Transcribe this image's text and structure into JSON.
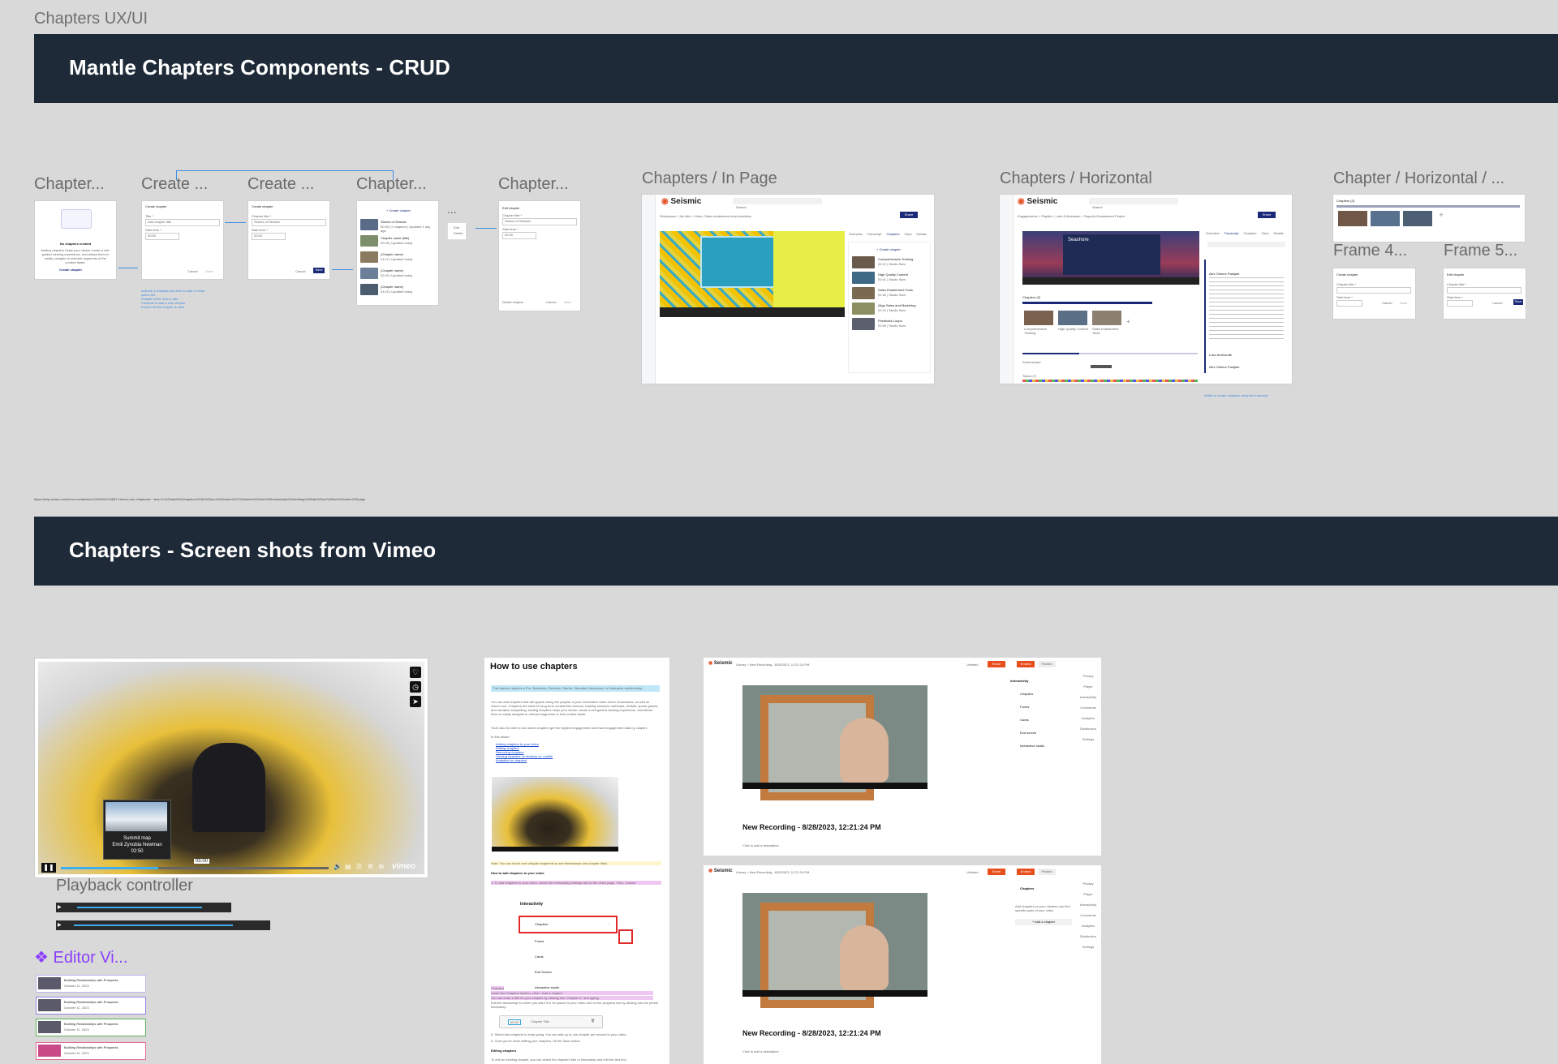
{
  "page": {
    "title": "Chapters UX/UI"
  },
  "sections": {
    "crud": {
      "title": "Mantle Chapters Components - CRUD"
    },
    "vimeo": {
      "title": "Chapters - Screen shots from Vimeo"
    }
  },
  "frames": {
    "chapter_empty": {
      "label": "Chapter...",
      "heading": "No chapters created",
      "body": "Adding chapters helps your viewer create a self-guided viewing experience, and allows them to easily navigate to relevant segments of the content faster.",
      "button": "Create chapter",
      "note": [
        "Indicate a template any time to start or close action list",
        "Suitable to the first to add",
        "Continue to add a new chapter",
        "Ensure all this chapter is valid"
      ]
    },
    "create_1": {
      "label": "Create ...",
      "title": "Create chapter",
      "field1_label": "Title *",
      "field1_placeholder": "Add chapter title",
      "field2_label": "Start time *",
      "field2_value": "00:00",
      "cancel": "Cancel",
      "save": "Save"
    },
    "create_2": {
      "label": "Create ...",
      "title": "Create chapter",
      "field1_label": "Chapter title *",
      "field1_value": "Stories of Seismic",
      "field2_label": "Start time *",
      "field2_value": "00:00",
      "cancel": "Cancel",
      "save": "Save"
    },
    "chapter_list": {
      "label": "Chapter...",
      "add": "+ Create chapter",
      "items": [
        {
          "title": "Stories of Seismic",
          "meta": "00:00 | 2 chapters | Updated 1 day ago"
        },
        {
          "title": "Chapter name (title)",
          "meta": "00:45 | Updated today"
        },
        {
          "title": "(Chapter name)",
          "meta": "01:12 | Updated today"
        },
        {
          "title": "(Chapter name)",
          "meta": "02:40 | Updated today"
        },
        {
          "title": "(Chapter name)",
          "meta": "03:15 | Updated today"
        }
      ]
    },
    "menu": {
      "more": "...",
      "edit": "Edit",
      "delete": "Delete"
    },
    "edit_chapter": {
      "label": "Chapter...",
      "title": "Edit chapter",
      "field1_label": "Chapter title *",
      "field1_value": "Stories of Seismic",
      "field2_label": "Start time *",
      "field2_value": "00:00",
      "delete": "Delete chapter",
      "cancel": "Cancel",
      "save": "Save"
    },
    "in_page": {
      "label": "Chapters / In Page",
      "brand": "Seismic",
      "search": "Search",
      "breadcrumb": "Workspace  >  My files  >  Video: Sales enablement best practices",
      "share": "Share",
      "tabs": [
        "Overview",
        "Transcript",
        "Chapters",
        "Clips",
        "Details"
      ],
      "create": "+ Create chapter",
      "chapters": [
        {
          "title": "Comprehensive Training",
          "meta": "00:12 | Studio Sam"
        },
        {
          "title": "High Quality Content",
          "meta": "00:41 | Studio Sam"
        },
        {
          "title": "Sales Enablement Tools",
          "meta": "01:30 | Studio Sam"
        },
        {
          "title": "Align Sales and Marketing",
          "meta": "02:10 | Studio Sam"
        },
        {
          "title": "Feedback Loops",
          "meta": "02:55 | Studio Sam"
        }
      ]
    },
    "horizontal": {
      "label": "Chapters / Horizontal",
      "brand": "Seismic",
      "search": "Search",
      "breadcrumb": "Engagements  >  Playlist  >  Luke & Alexander - Paypal's Enablement Project",
      "share": "Share",
      "tabs": [
        "Overview",
        "Transcript",
        "Chapters",
        "Clips",
        "Details"
      ],
      "video_title": "Seashore",
      "chapters_heading": "Chapters (3)",
      "chapter_names": [
        "Comprehensive Training",
        "High Quality Content",
        "Sales Enablement Tools"
      ],
      "screenshare": "Screenshare",
      "topics": "Topics (7)",
      "speaker1": "Alex Gutierz Pastjant",
      "speaker2": "Luke Ambroudé",
      "speaker3": "Alex Gutierz Pastjant",
      "note": "Ability to create chapters using the transcript"
    },
    "horizontal_2": {
      "label": "Chapter / Horizontal / ...",
      "chapters_heading": "Chapters (3)",
      "frame4_label": "Frame 4...",
      "frame5_label": "Frame 5...",
      "create_title": "Create chapter",
      "edit_title": "Edit chapter",
      "field_label": "Chapter title *",
      "time_label": "Start time *",
      "cancel": "Cancel",
      "save": "Save"
    },
    "url": "https://help.vimeo.com/hc/en-us/articles/12425001234567-How-to-use-chapters#:~:text=To%20add%20chapters%20to%20your%20video%2C%20select%20the%20Interactivity%20settings%20tab%20on%20the%20video%20page"
  },
  "vimeo": {
    "player": {
      "chapter_title": "Summit map",
      "chapter_person": "Emili Zynobia Newman",
      "chapter_time": "02:50",
      "tooltip_time": "05:00",
      "logo": "vimeo"
    },
    "playback_label": "Playback controller",
    "editor_label": "❖ Editor Vi...",
    "editor_items": [
      {
        "title": "Building Relationships with Prospects",
        "date": "October 11, 2023"
      },
      {
        "title": "Building Relationships with Prospects",
        "date": "October 11, 2023"
      },
      {
        "title": "Building Relationships with Prospects",
        "date": "October 11, 2023"
      },
      {
        "title": "Building Relationships with Prospects",
        "date": "October 11, 2023"
      }
    ],
    "howto": {
      "title": "How to use chapters",
      "notice": "This feature requires a Pro, Business, Premium, Starter, Standard, Advanced, or Enterprise membership.",
      "para1": "You can add chapters that will appear along the playbar of your embedded video and in showcases, as well as vimeo.com. Chapters are ideal for long-form content like lessons, training sessions, webinars, recitals, sports games, and narrative storytelling. Adding chapters helps your viewer create a self-guided viewing experience, and allows them to easily navigate to relevant segments to find content faster.",
      "para2": "You'll also be able to see which chapters get the highest engagement and track engagement data by chapter.",
      "in_article": "In this article:",
      "toc": [
        "Adding chapters to your video",
        "Editing chapters",
        "Removing chapters",
        "Viewing chapters on desktop vs. mobile",
        "Analytics for chapters"
      ],
      "note": "Note: You can hover over chapter segments to see timestamps and chapter titles.",
      "how_heading": "How to add chapters to your video",
      "step1": "1. To add chapters to your video, select the Interactivity settings tab on the video page. Then, choose",
      "interactivity": "Interactivity",
      "menu": [
        "Chapters",
        "Forms",
        "Cards",
        "End Screen",
        "Interactive studio"
      ],
      "chapters_label": "Chapters",
      "steps": [
        "Under the Chapters section, click + Add a chapter.",
        "You can enter a title for your chapter by clicking into \"Chapter 1\" and typing.",
        "Edit the timestamp for when you want it to be placed in your video and on the progress bar by clicking into the preset timestamp."
      ],
      "time": "00:00",
      "chapter_title": "Chapter Title",
      "step_more": "5. Select Add chapters to keep going. You can add up to one chapter per second in your video.",
      "step_done": "6. Once you're done editing your chapters, hit the Save button.",
      "editing": "Editing chapters",
      "editing_body": "To edit an existing chapter, you can select the chapter's title or timestamp and edit the text box."
    },
    "editor": {
      "brand": "Seismic",
      "crumbs": "Library  >  New Recording - 8/28/2023, 12:21:24 PM",
      "unlisted": "Unlisted",
      "share": "Share",
      "embed": "Embed",
      "publish": "Publish",
      "title": "New Recording - 8/28/2023, 12:21:24 PM",
      "desc": "Click to add a description",
      "interactivity": "Interactivity",
      "options": [
        "Chapters",
        "Forms",
        "Cards",
        "End screen",
        "Interactive studio"
      ],
      "chapters_panel": "Chapters",
      "chapters_hint": "Add chapters so your viewers can find specific parts of your video",
      "add_chapter": "+ Add a chapter",
      "right_icons": [
        "Privacy",
        "Player",
        "Interactivity",
        "Comments",
        "Analytics",
        "Distribution",
        "Settings"
      ]
    }
  }
}
